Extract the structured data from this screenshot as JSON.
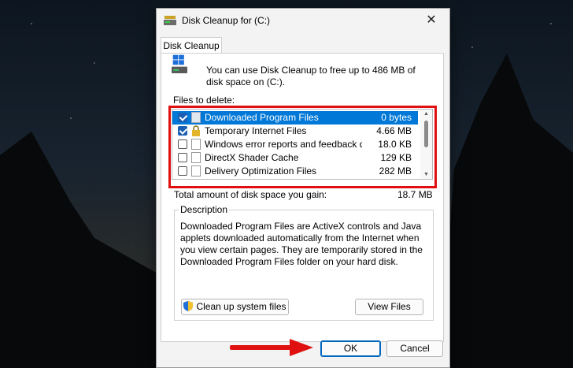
{
  "window": {
    "title": "Disk Cleanup for  (C:)",
    "close_glyph": "✕"
  },
  "tabs": [
    {
      "label": "Disk Cleanup",
      "active": true
    }
  ],
  "intro_text": "You can use Disk Cleanup to free up to 486 MB of disk space on  (C:).",
  "files_to_delete_label": "Files to delete:",
  "files": [
    {
      "name": "Downloaded Program Files",
      "size": "0 bytes",
      "checked": true,
      "selected": true,
      "icon": "folder-icon"
    },
    {
      "name": "Temporary Internet Files",
      "size": "4.66 MB",
      "checked": true,
      "selected": false,
      "icon": "lock-icon"
    },
    {
      "name": "Windows error reports and feedback di...",
      "size": "18.0 KB",
      "checked": false,
      "selected": false,
      "icon": "file-icon"
    },
    {
      "name": "DirectX Shader Cache",
      "size": "129 KB",
      "checked": false,
      "selected": false,
      "icon": "file-icon"
    },
    {
      "name": "Delivery Optimization Files",
      "size": "282 MB",
      "checked": false,
      "selected": false,
      "icon": "file-icon"
    }
  ],
  "total": {
    "label": "Total amount of disk space you gain:",
    "value": "18.7 MB"
  },
  "description": {
    "title": "Description",
    "text": "Downloaded Program Files are ActiveX controls and Java applets downloaded automatically from the Internet when you view certain pages. They are temporarily stored in the Downloaded Program Files folder on your hard disk."
  },
  "buttons": {
    "cleanup_system": "Clean up system files",
    "view_files": "View Files",
    "ok": "OK",
    "cancel": "Cancel"
  },
  "colors": {
    "selection": "#0078d7",
    "highlight_box": "#e01010",
    "arrow": "#e01010",
    "primary_border": "#0067c0"
  }
}
